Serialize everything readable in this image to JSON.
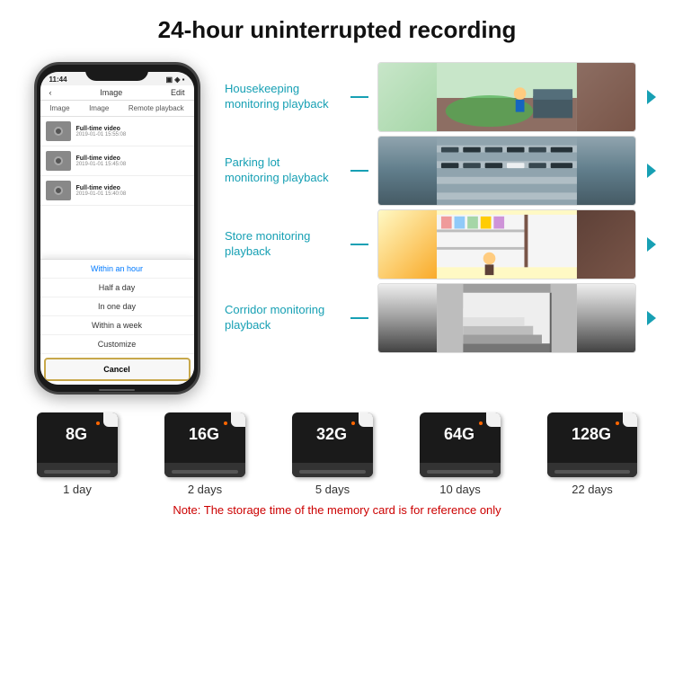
{
  "header": {
    "title": "24-hour uninterrupted recording"
  },
  "phone": {
    "time": "11:44",
    "screen_title": "Image",
    "screen_edit": "Edit",
    "tabs": [
      "Image",
      "Image",
      "Remote playback"
    ],
    "list_items": [
      {
        "title": "Full-time video",
        "date": "2019-01-01 15:55:08"
      },
      {
        "title": "Full-time video",
        "date": "2019-01-01 15:45:08"
      },
      {
        "title": "Full-time video",
        "date": "2019-01-01 15:40:08"
      }
    ],
    "dropdown_items": [
      "Within an hour",
      "Half a day",
      "In one day",
      "Within a week",
      "Customize"
    ],
    "cancel_label": "Cancel"
  },
  "monitoring": {
    "items": [
      {
        "label": "Housekeeping\nmonitoring playback",
        "img_type": "housekeeping"
      },
      {
        "label": "Parking lot\nmonitoring playback",
        "img_type": "parking"
      },
      {
        "label": "Store monitoring\nplayback",
        "img_type": "store"
      },
      {
        "label": "Corridor monitoring\nplayback",
        "img_type": "corridor"
      }
    ]
  },
  "storage": {
    "cards": [
      {
        "size": "8G",
        "days": "1 day"
      },
      {
        "size": "16G",
        "days": "2 days"
      },
      {
        "size": "32G",
        "days": "5 days"
      },
      {
        "size": "64G",
        "days": "10 days"
      },
      {
        "size": "128G",
        "days": "22 days"
      }
    ],
    "note": "Note: The storage time of the memory card is for reference only"
  }
}
